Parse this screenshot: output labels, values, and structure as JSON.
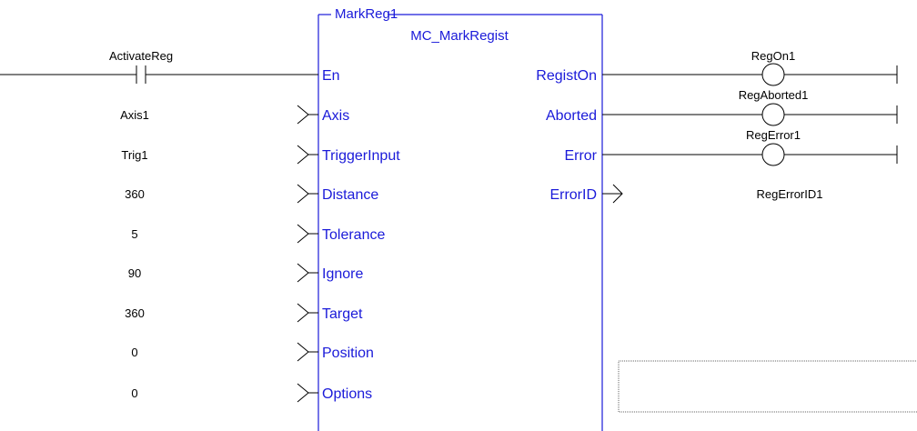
{
  "block": {
    "instance": "MarkReg1",
    "type": "MC_MarkRegist"
  },
  "enable": {
    "contact_label": "ActivateReg",
    "pin": "En"
  },
  "inputs": [
    {
      "value": "Axis1",
      "pin": "Axis"
    },
    {
      "value": "Trig1",
      "pin": "TriggerInput"
    },
    {
      "value": "360",
      "pin": "Distance"
    },
    {
      "value": "5",
      "pin": "Tolerance"
    },
    {
      "value": "90",
      "pin": "Ignore"
    },
    {
      "value": "360",
      "pin": "Target"
    },
    {
      "value": "0",
      "pin": "Position"
    },
    {
      "value": "0",
      "pin": "Options"
    }
  ],
  "outputs": [
    {
      "pin": "RegistOn",
      "variable": "RegOn1"
    },
    {
      "pin": "Aborted",
      "variable": "RegAborted1"
    },
    {
      "pin": "Error",
      "variable": "RegError1"
    },
    {
      "pin": "ErrorID",
      "variable": "RegErrorID1"
    }
  ],
  "colors": {
    "block": "#1a1ad9",
    "wire": "#000000"
  }
}
